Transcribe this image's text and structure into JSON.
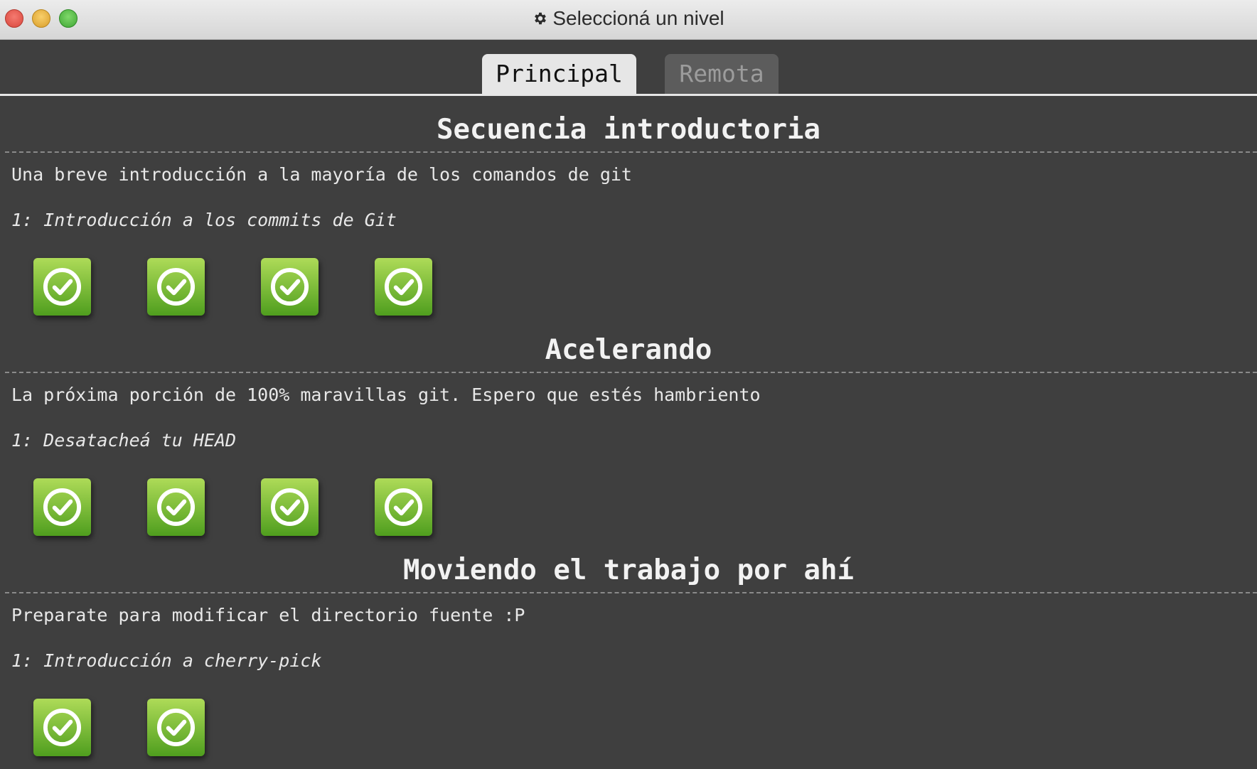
{
  "window": {
    "title": "Seleccioná un nivel"
  },
  "tabs": [
    {
      "label": "Principal",
      "active": true
    },
    {
      "label": "Remota",
      "active": false
    }
  ],
  "sequences": [
    {
      "title": "Secuencia introductoria",
      "description": "Una breve introducción a la mayoría de los comandos de git",
      "selected_level": "1: Introducción a los commits de Git",
      "levels_completed": 4
    },
    {
      "title": "Acelerando",
      "description": "La próxima porción de 100% maravillas git. Espero que estés hambriento",
      "selected_level": "1: Desatacheá tu HEAD",
      "levels_completed": 4
    },
    {
      "title": "Moviendo el trabajo por ahí",
      "description": "Preparate para modificar el directorio fuente :P",
      "selected_level": "1: Introducción a cherry-pick",
      "levels_completed": 2
    }
  ],
  "colors": {
    "background": "#3f3f3f",
    "level_complete": "#6fb52e",
    "tab_active": "#e6e6e6",
    "tab_inactive": "#5c5c5c"
  },
  "icons": {
    "level_complete": "check-circle-icon",
    "title": "gear-icon"
  }
}
